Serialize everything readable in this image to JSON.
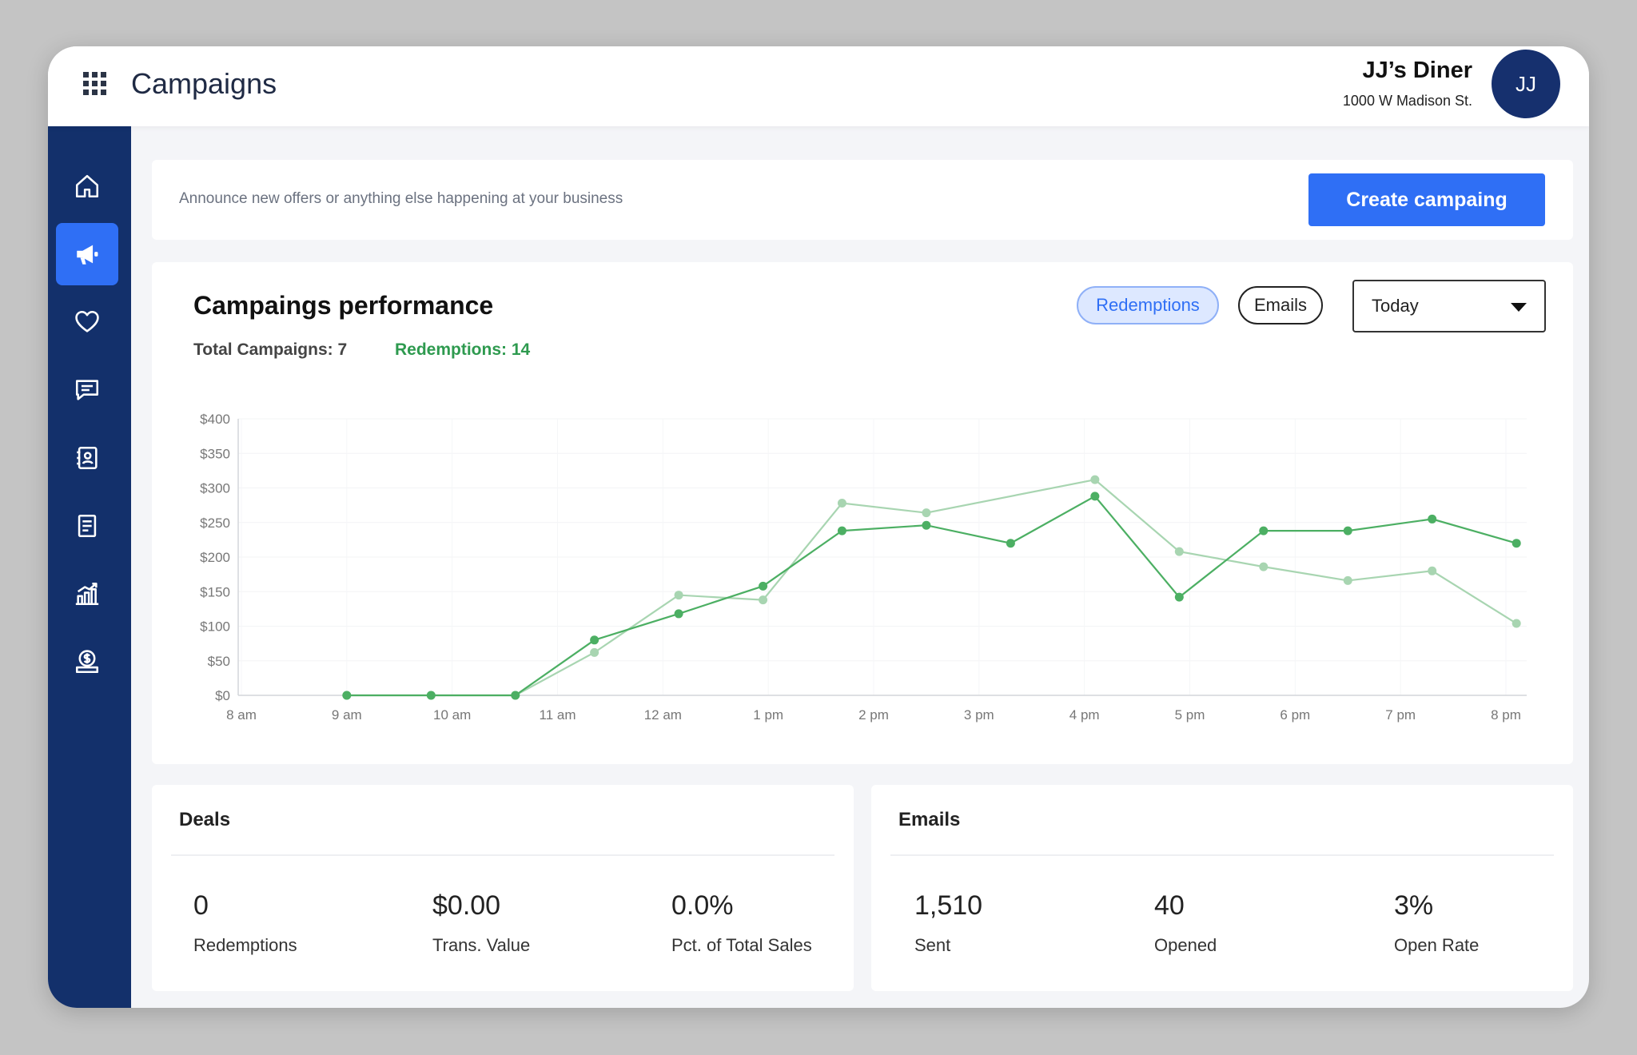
{
  "header": {
    "title": "Campaigns",
    "business_name": "JJ’s Diner",
    "business_address": "1000 W Madison St.",
    "avatar_initials": "JJ"
  },
  "sidebar": {
    "items": [
      {
        "icon": "home-icon",
        "active": false
      },
      {
        "icon": "megaphone-icon",
        "active": true
      },
      {
        "icon": "heart-icon",
        "active": false
      },
      {
        "icon": "chat-icon",
        "active": false
      },
      {
        "icon": "contacts-icon",
        "active": false
      },
      {
        "icon": "receipt-icon",
        "active": false
      },
      {
        "icon": "growth-chart-icon",
        "active": false
      },
      {
        "icon": "money-icon",
        "active": false
      }
    ]
  },
  "announce": {
    "text": "Announce new offers or anything else happening at your business",
    "button_label": "Create campaing"
  },
  "performance": {
    "title": "Campaings performance",
    "total_campaigns": "Total Campaigns: 7",
    "redemptions": "Redemptions: 14",
    "toggle_redemptions": "Redemptions",
    "toggle_emails": "Emails",
    "range_selected": "Today"
  },
  "chart_data": {
    "type": "line",
    "x": [
      "8 am",
      "9 am",
      "10 am",
      "11 am",
      "12 am",
      "1 pm",
      "2 pm",
      "3 pm",
      "4 pm",
      "5 pm",
      "6 pm",
      "7 pm",
      "8 pm"
    ],
    "ylim": [
      0,
      400
    ],
    "yticks": [
      "$0",
      "$50",
      "$100",
      "$150",
      "$200",
      "$250",
      "$300",
      "$350",
      "$400"
    ],
    "grid": true,
    "series": [
      {
        "color": "#4caf63",
        "points": [
          [
            1,
            0
          ],
          [
            1.8,
            0
          ],
          [
            2.6,
            0
          ],
          [
            3.35,
            80
          ],
          [
            4.15,
            118
          ],
          [
            4.95,
            158
          ],
          [
            5.7,
            238
          ],
          [
            6.5,
            246
          ],
          [
            7.3,
            220
          ],
          [
            8.1,
            288
          ],
          [
            8.9,
            142
          ],
          [
            9.7,
            238
          ],
          [
            10.5,
            238
          ],
          [
            11.3,
            255
          ],
          [
            12.1,
            220
          ]
        ]
      },
      {
        "color": "#a8d5b1",
        "points": [
          [
            1,
            0
          ],
          [
            1.8,
            0
          ],
          [
            2.6,
            0
          ],
          [
            3.35,
            62
          ],
          [
            4.15,
            145
          ],
          [
            4.95,
            138
          ],
          [
            5.7,
            278
          ],
          [
            6.5,
            264
          ],
          [
            8.1,
            312
          ],
          [
            8.9,
            208
          ],
          [
            9.7,
            186
          ],
          [
            10.5,
            166
          ],
          [
            11.3,
            180
          ],
          [
            12.1,
            104
          ]
        ]
      }
    ]
  },
  "deals": {
    "title": "Deals",
    "stats": [
      {
        "value": "0",
        "label": "Redemptions"
      },
      {
        "value": "$0.00",
        "label": "Trans. Value"
      },
      {
        "value": "0.0%",
        "label": "Pct. of Total Sales"
      }
    ]
  },
  "emails": {
    "title": "Emails",
    "stats": [
      {
        "value": "1,510",
        "label": "Sent"
      },
      {
        "value": "40",
        "label": "Opened"
      },
      {
        "value": "3%",
        "label": "Open Rate"
      }
    ]
  }
}
